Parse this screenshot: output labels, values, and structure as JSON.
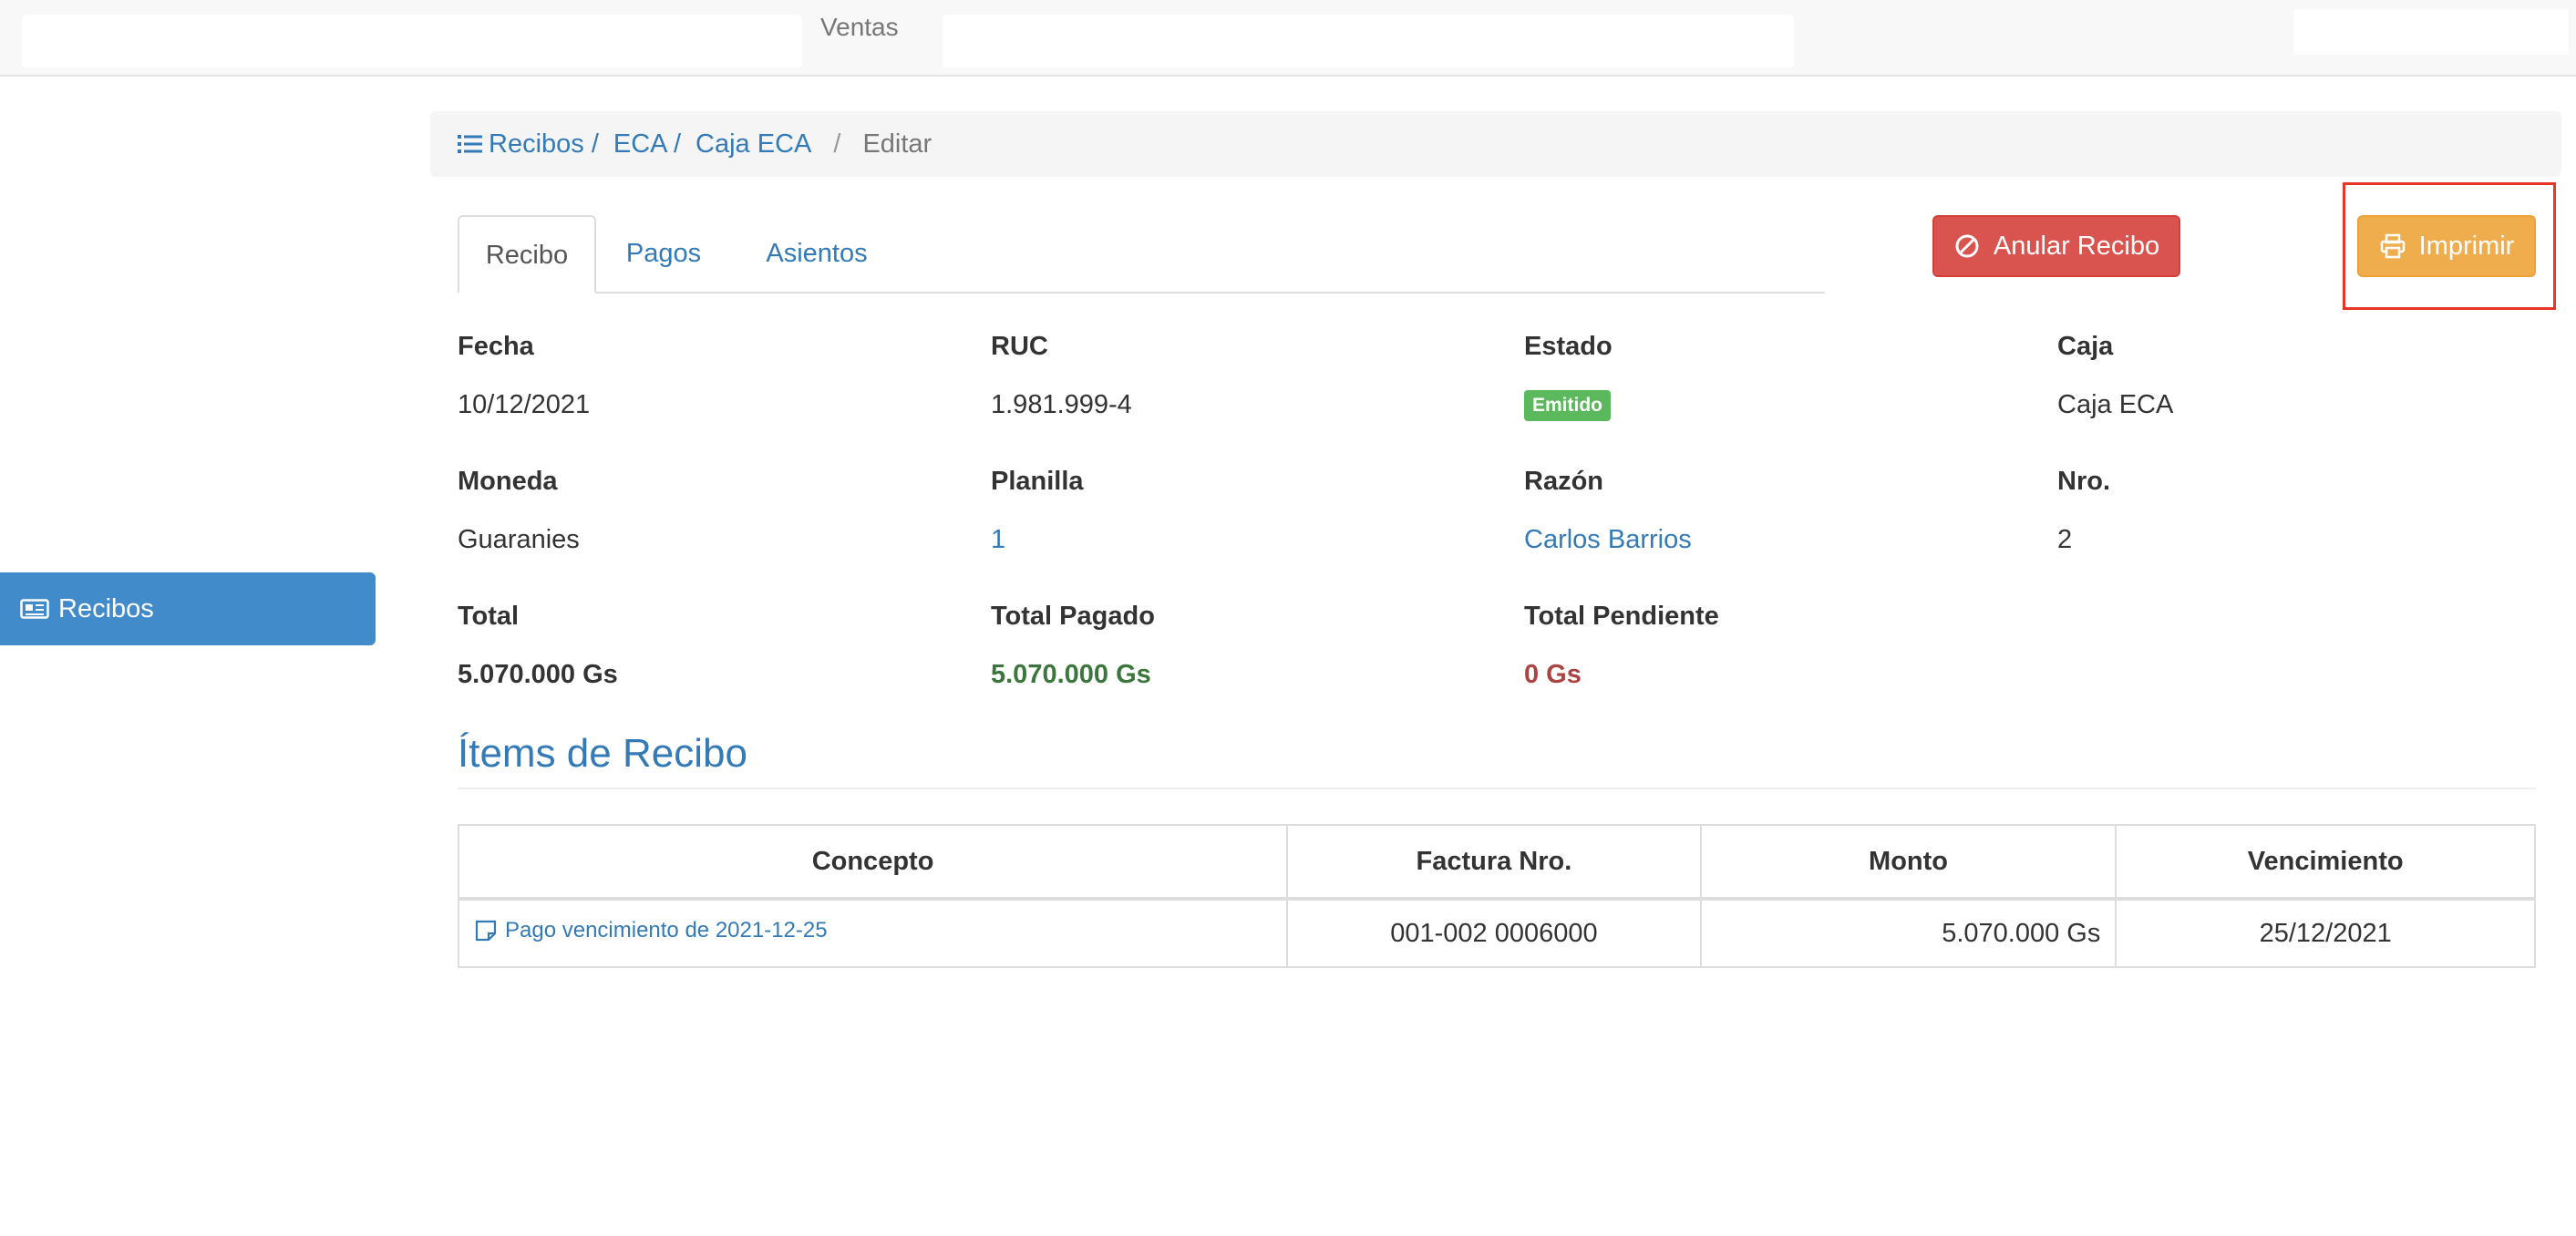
{
  "header": {
    "brand": "Ventas"
  },
  "sidebar": {
    "items": [
      {
        "label": "Recibos",
        "icon": "newspaper-icon"
      }
    ]
  },
  "breadcrumb": {
    "items": [
      "Recibos /",
      "ECA /",
      "Caja ECA",
      "/",
      "Editar"
    ],
    "icon": "list-icon"
  },
  "tabs": [
    {
      "label": "Recibo",
      "active": true
    },
    {
      "label": "Pagos",
      "active": false
    },
    {
      "label": "Asientos",
      "active": false
    }
  ],
  "actions": {
    "annul_label": "Anular Recibo",
    "print_label": "Imprimir",
    "danger_color": "#d9534f",
    "warning_color": "#f0ad4e"
  },
  "details": {
    "fecha": {
      "label": "Fecha",
      "value": "10/12/2021"
    },
    "ruc": {
      "label": "RUC",
      "value": "1.981.999-4"
    },
    "estado": {
      "label": "Estado",
      "value": "Emitido"
    },
    "caja": {
      "label": "Caja",
      "value": "Caja ECA"
    },
    "moneda": {
      "label": "Moneda",
      "value": "Guaranies"
    },
    "planilla": {
      "label": "Planilla",
      "value": "1"
    },
    "razon": {
      "label": "Razón",
      "value": "Carlos Barrios"
    },
    "nro": {
      "label": "Nro.",
      "value": "2"
    },
    "total": {
      "label": "Total",
      "value": "5.070.000 Gs"
    },
    "total_pagado": {
      "label": "Total Pagado",
      "value": "5.070.000 Gs"
    },
    "total_pendiente": {
      "label": "Total Pendiente",
      "value": "0 Gs"
    }
  },
  "items_section": {
    "title": "Ítems de Recibo",
    "columns": [
      "Concepto",
      "Factura Nro.",
      "Monto",
      "Vencimiento"
    ],
    "rows": [
      {
        "concepto": "Pago vencimiento de 2021-12-25",
        "factura": "001-002 0006000",
        "monto": "5.070.000 Gs",
        "vencimiento": "25/12/2021"
      }
    ]
  }
}
